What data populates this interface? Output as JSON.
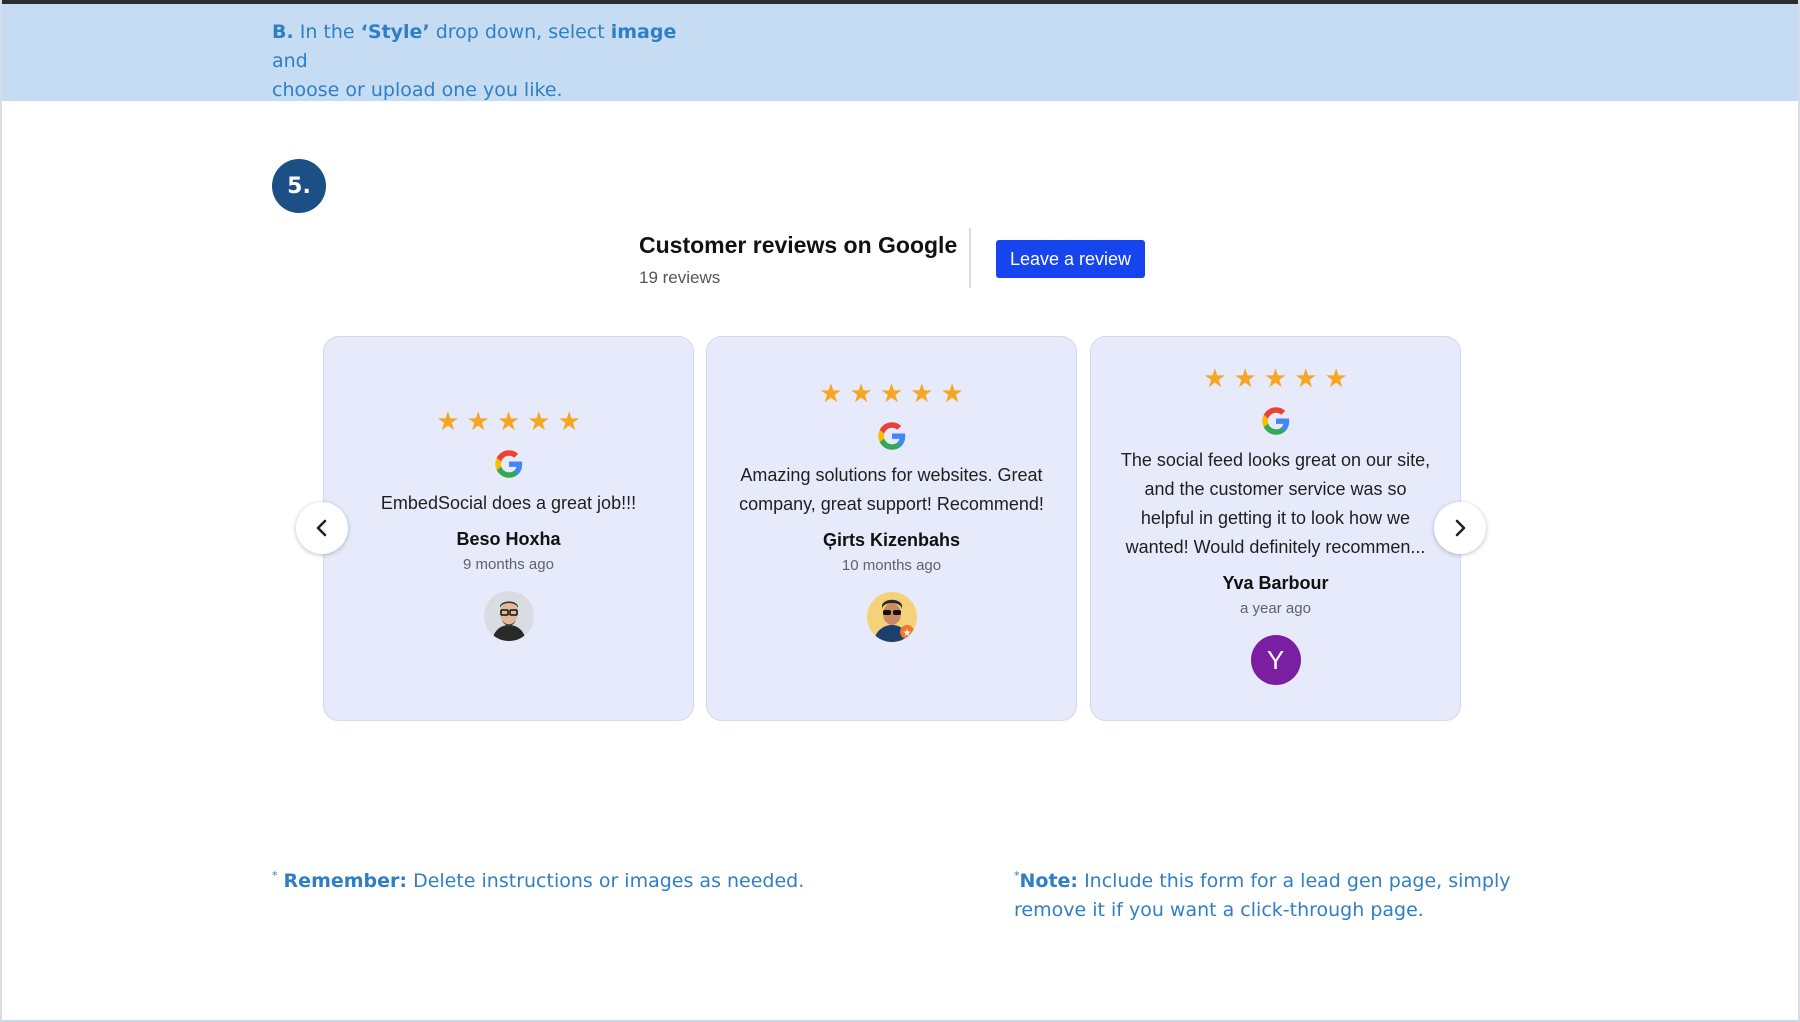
{
  "instruction_top": {
    "step_letter": "B.",
    "text_1": "In the",
    "style_word": "‘Style’",
    "text_2": "drop down, select",
    "image_word": "image",
    "text_3": "and",
    "line_2": "choose or upload one you like."
  },
  "step": {
    "number": "5."
  },
  "widget": {
    "title": "Customer reviews on Google",
    "count": "19 reviews",
    "button_label": "Leave a review",
    "icons": {
      "prev": "chevron-left-icon",
      "next": "chevron-right-icon",
      "source": "google-icon",
      "rating": "star-icon"
    },
    "colors": {
      "button": "#1645f0",
      "card": "#e6eafb",
      "star": "#f6a623"
    },
    "reviews": [
      {
        "rating": 5,
        "text": "EmbedSocial does a great job!!!",
        "name": "Beso Hoxha",
        "time": "9 months ago",
        "avatar": "photo"
      },
      {
        "rating": 5,
        "text": "Amazing solutions for websites. Great company, great support! Recommend!",
        "name": "Ģirts Kizenbahs",
        "time": "10 months ago",
        "avatar": "photo"
      },
      {
        "rating": 5,
        "text": "The social feed looks great on our site, and the customer service was so helpful in getting it to look how we wanted! Would definitely recommen...",
        "name": "Yva Barbour",
        "time": "a year ago",
        "avatar_letter": "Y"
      }
    ]
  },
  "notes": {
    "remember_mark": "*",
    "remember_label": "Remember:",
    "remember_text": "Delete instructions or images as needed.",
    "note_mark": "*",
    "note_label": "Note:",
    "note_text_1": "Include this form for a lead gen page, simply",
    "note_text_2": "remove it if you want a click-through page."
  }
}
